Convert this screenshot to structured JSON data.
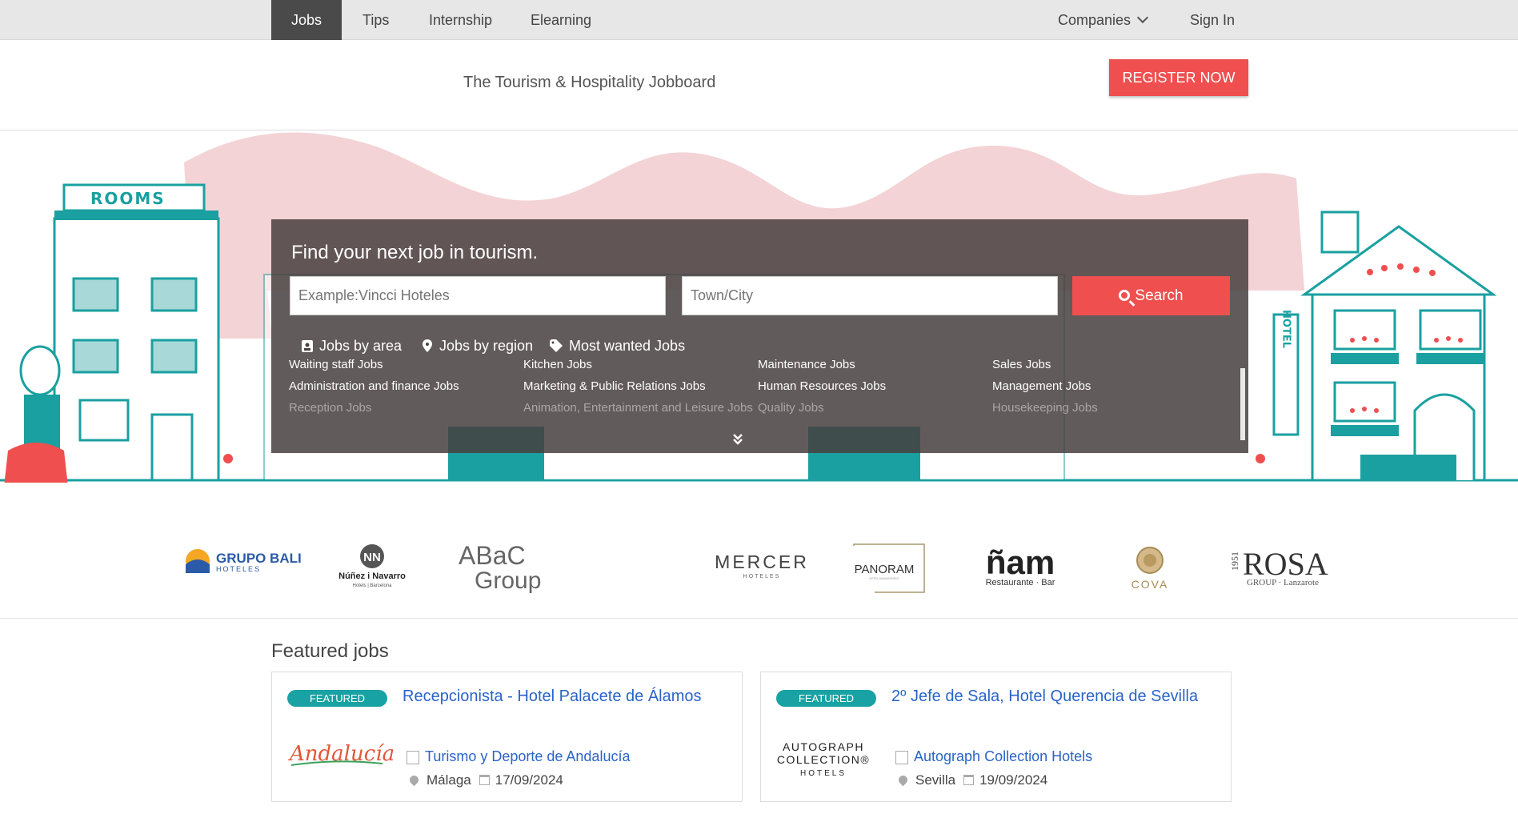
{
  "nav": {
    "items": [
      {
        "label": "Jobs",
        "active": true
      },
      {
        "label": "Tips",
        "active": false
      },
      {
        "label": "Internship",
        "active": false
      },
      {
        "label": "Elearning",
        "active": false
      }
    ],
    "companies_label": "Companies",
    "signin_label": "Sign In"
  },
  "header": {
    "tagline": "The Tourism & Hospitality Jobboard",
    "register_label": "REGISTER NOW"
  },
  "search": {
    "title": "Find your next job in tourism.",
    "keyword_placeholder": "Example:Vincci Hoteles",
    "location_placeholder": "Town/City",
    "button_label": "Search",
    "tabs": [
      "Jobs by area",
      "Jobs by region",
      "Most wanted Jobs"
    ],
    "categories": [
      [
        "Waiting staff Jobs",
        "Administration and finance Jobs",
        "Reception Jobs"
      ],
      [
        "Kitchen Jobs",
        "Marketing & Public Relations Jobs",
        "Animation, Entertainment and Leisure Jobs"
      ],
      [
        "Maintenance Jobs",
        "Human Resources Jobs",
        "Quality Jobs"
      ],
      [
        "Sales Jobs",
        "Management Jobs",
        "Housekeeping Jobs"
      ]
    ]
  },
  "hero_signs": {
    "rooms": "ROOMS",
    "hotel": "HOTEL"
  },
  "logos": [
    {
      "name": "GRUPO BALI",
      "sub": "HOTELES"
    },
    {
      "name": "Núñez i Navarro",
      "sub": "Hotels | Barcelona"
    },
    {
      "name": "ABaC",
      "sub": "Group"
    },
    {
      "name": "MERCER",
      "sub": "HOTELES"
    },
    {
      "name": "PANORAM",
      "sub": "HOTEL MANAGEMENT"
    },
    {
      "name": "ñam",
      "sub": "Restaurante · Bar"
    },
    {
      "name": "COVA",
      "sub": ""
    },
    {
      "name": "ROSA",
      "sub": "GROUP · Lanzarote",
      "year": "1951"
    }
  ],
  "featured": {
    "title": "Featured jobs",
    "badge_label": "FEATURED",
    "jobs": [
      {
        "title": "Recepcionista - Hotel Palacete de Álamos",
        "company": "Turismo y Deporte de Andalucía",
        "logo_text": "Andalucía",
        "location": "Málaga",
        "date": "17/09/2024"
      },
      {
        "title": "2º Jefe de Sala, Hotel Querencia de Sevilla",
        "company": "Autograph Collection Hotels",
        "logo_lines": [
          "AUTOGRAPH",
          "COLLECTION®",
          "HOTELS"
        ],
        "location": "Sevilla",
        "date": "19/09/2024"
      }
    ]
  },
  "colors": {
    "accent_red": "#ef4f4f",
    "teal": "#19a2a3",
    "link_blue": "#2a64c8",
    "panel": "#463e3e"
  }
}
